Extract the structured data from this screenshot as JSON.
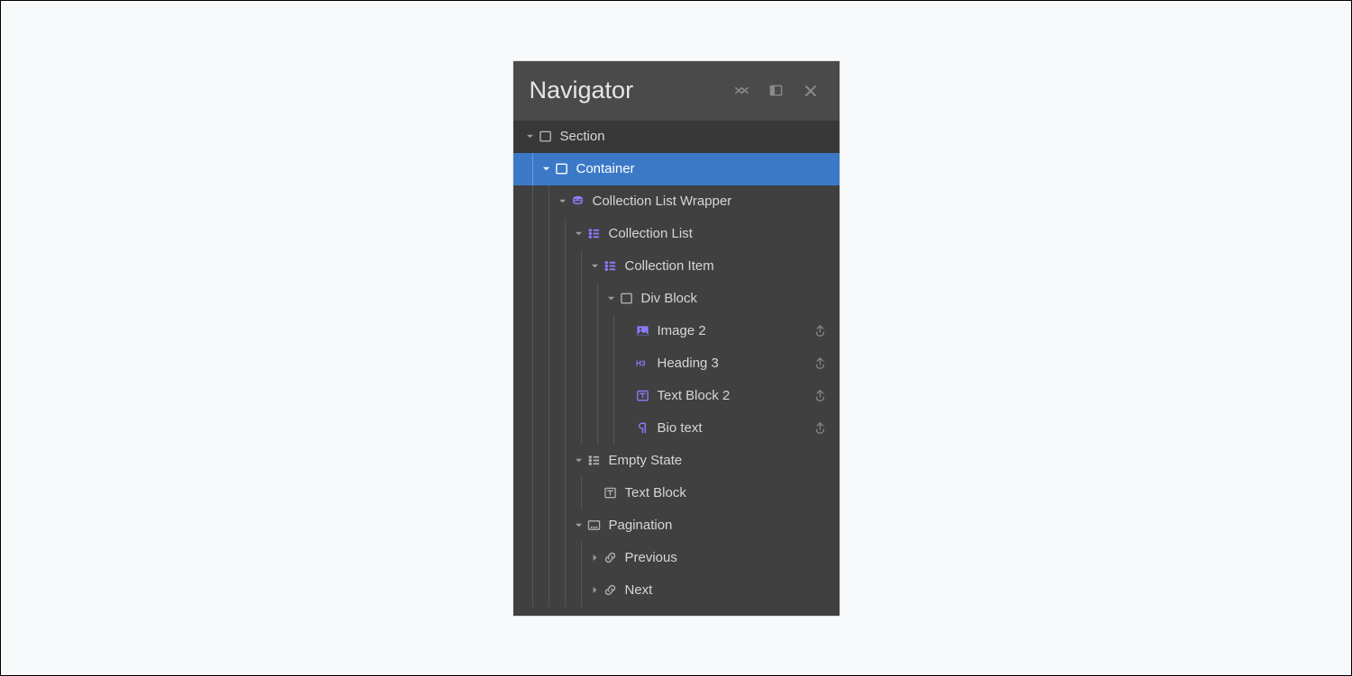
{
  "header": {
    "title": "Navigator"
  },
  "rows": [
    {
      "id": "section",
      "depth": 0,
      "arrow": "expanded",
      "icon": "box",
      "iconColor": "default",
      "label": "Section",
      "bound": false,
      "selected": false,
      "dark": true
    },
    {
      "id": "container",
      "depth": 1,
      "arrow": "expanded",
      "icon": "box",
      "iconColor": "default",
      "label": "Container",
      "bound": false,
      "selected": true,
      "dark": false
    },
    {
      "id": "cl-wrapper",
      "depth": 2,
      "arrow": "expanded",
      "icon": "stack",
      "iconColor": "purple",
      "label": "Collection List Wrapper",
      "bound": false,
      "selected": false,
      "dark": false
    },
    {
      "id": "cl-list",
      "depth": 3,
      "arrow": "expanded",
      "icon": "list",
      "iconColor": "purple",
      "label": "Collection List",
      "bound": false,
      "selected": false,
      "dark": false
    },
    {
      "id": "cl-item",
      "depth": 4,
      "arrow": "expanded",
      "icon": "list",
      "iconColor": "purple",
      "label": "Collection Item",
      "bound": false,
      "selected": false,
      "dark": false
    },
    {
      "id": "div-block",
      "depth": 5,
      "arrow": "expanded",
      "icon": "box",
      "iconColor": "default",
      "label": "Div Block",
      "bound": false,
      "selected": false,
      "dark": false
    },
    {
      "id": "image2",
      "depth": 6,
      "arrow": "none",
      "icon": "image",
      "iconColor": "purple",
      "label": "Image 2",
      "bound": true,
      "selected": false,
      "dark": false
    },
    {
      "id": "heading3",
      "depth": 6,
      "arrow": "none",
      "icon": "h3",
      "iconColor": "purple",
      "label": "Heading 3",
      "bound": true,
      "selected": false,
      "dark": false
    },
    {
      "id": "textblock2",
      "depth": 6,
      "arrow": "none",
      "icon": "text",
      "iconColor": "purple",
      "label": "Text Block 2",
      "bound": true,
      "selected": false,
      "dark": false
    },
    {
      "id": "bio-text",
      "depth": 6,
      "arrow": "none",
      "icon": "paragraph",
      "iconColor": "purple",
      "label": "Bio text",
      "bound": true,
      "selected": false,
      "dark": false
    },
    {
      "id": "empty-state",
      "depth": 3,
      "arrow": "expanded",
      "icon": "list",
      "iconColor": "default",
      "label": "Empty State",
      "bound": false,
      "selected": false,
      "dark": false
    },
    {
      "id": "textblock",
      "depth": 4,
      "arrow": "none",
      "icon": "text",
      "iconColor": "default",
      "label": "Text Block",
      "bound": false,
      "selected": false,
      "dark": false
    },
    {
      "id": "pagination",
      "depth": 3,
      "arrow": "expanded",
      "icon": "pagination",
      "iconColor": "default",
      "label": "Pagination",
      "bound": false,
      "selected": false,
      "dark": false
    },
    {
      "id": "previous",
      "depth": 4,
      "arrow": "collapsed",
      "icon": "link",
      "iconColor": "default",
      "label": "Previous",
      "bound": false,
      "selected": false,
      "dark": false
    },
    {
      "id": "next",
      "depth": 4,
      "arrow": "collapsed",
      "icon": "link",
      "iconColor": "default",
      "label": "Next",
      "bound": false,
      "selected": false,
      "dark": false
    }
  ]
}
